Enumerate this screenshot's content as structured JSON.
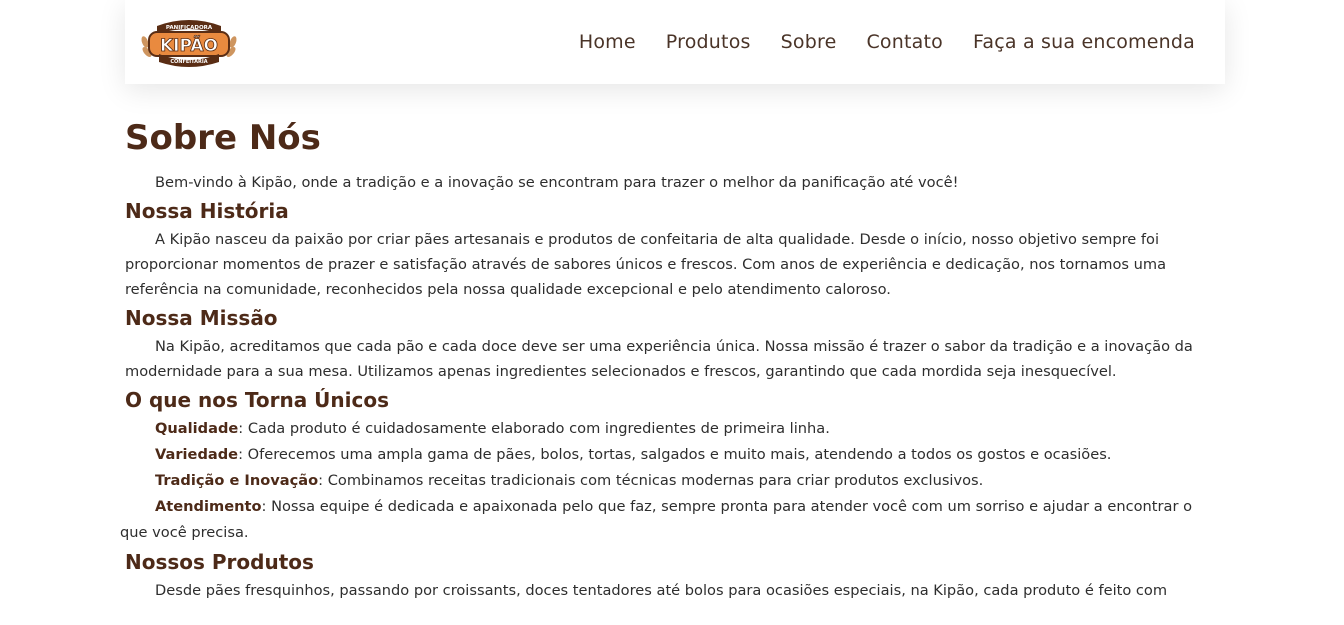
{
  "brand": {
    "logo_top_text": "PANIFICADORA",
    "logo_main_text": "KIPÃO",
    "logo_bottom_text": "CONFEITARIA"
  },
  "nav": {
    "items": [
      {
        "label": "Home"
      },
      {
        "label": "Produtos"
      },
      {
        "label": "Sobre"
      },
      {
        "label": "Contato"
      },
      {
        "label": "Faça a sua encomenda"
      }
    ]
  },
  "page": {
    "title": "Sobre Nós",
    "intro": "Bem-vindo à Kipão, onde a tradição e a inovação se encontram para trazer o melhor da panificação até você!"
  },
  "sections": {
    "history": {
      "heading": "Nossa História",
      "text": "A Kipão nasceu da paixão por criar pães artesanais e produtos de confeitaria de alta qualidade. Desde o início, nosso objetivo sempre foi proporcionar momentos de prazer e satisfação através de sabores únicos e frescos. Com anos de experiência e dedicação, nos tornamos uma referência na comunidade, reconhecidos pela nossa qualidade excepcional e pelo atendimento caloroso."
    },
    "mission": {
      "heading": "Nossa Missão",
      "text": "Na Kipão, acreditamos que cada pão e cada doce deve ser uma experiência única. Nossa missão é trazer o sabor da tradição e a inovação da modernidade para a sua mesa. Utilizamos apenas ingredientes selecionados e frescos, garantindo que cada mordida seja inesquecível."
    },
    "unique": {
      "heading": "O que nos Torna Únicos",
      "items": [
        {
          "title": "Qualidade",
          "text": ": Cada produto é cuidadosamente elaborado com ingredientes de primeira linha."
        },
        {
          "title": "Variedade",
          "text": ": Oferecemos uma ampla gama de pães, bolos, tortas, salgados e muito mais, atendendo a todos os gostos e ocasiões."
        },
        {
          "title": "Tradição e Inovação",
          "text": ": Combinamos receitas tradicionais com técnicas modernas para criar produtos exclusivos."
        },
        {
          "title": "Atendimento",
          "text": ": Nossa equipe é dedicada e apaixonada pelo que faz, sempre pronta para atender você com um sorriso e ajudar a encontrar o que você precisa."
        }
      ]
    },
    "products": {
      "heading": "Nossos Produtos",
      "text": "Desde pães fresquinhos, passando por croissants, doces tentadores até bolos para ocasiões especiais, na Kipão, cada produto é feito com"
    }
  },
  "colors": {
    "heading_brown": "#4d2a18",
    "nav_text": "#4a3428",
    "logo_orange": "#e98a3f",
    "logo_dark": "#5a2d14"
  }
}
